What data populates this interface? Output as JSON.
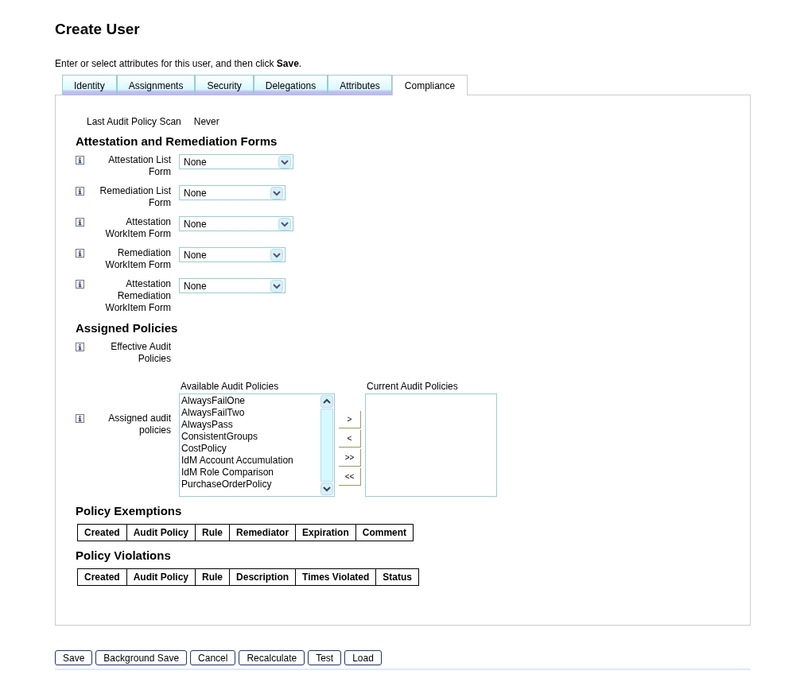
{
  "page": {
    "title": "Create User",
    "instruction": "Enter or select attributes for this user, and then click **Save**."
  },
  "tabs": [
    {
      "label": "Identity",
      "selected": false
    },
    {
      "label": "Assignments",
      "selected": false
    },
    {
      "label": "Security",
      "selected": false
    },
    {
      "label": "Delegations",
      "selected": false
    },
    {
      "label": "Attributes",
      "selected": false
    },
    {
      "label": "Compliance",
      "selected": true
    }
  ],
  "last_scan": {
    "label": "Last Audit Policy Scan",
    "value": "Never"
  },
  "forms_section": {
    "heading": "Attestation and Remediation Forms",
    "fields": [
      {
        "label": "Attestation List Form",
        "value": "None"
      },
      {
        "label": "Remediation List Form",
        "value": "None"
      },
      {
        "label": "Attestation WorkItem Form",
        "value": "None"
      },
      {
        "label": "Remediation WorkItem Form",
        "value": "None"
      },
      {
        "label": "Attestation Remediation WorkItem Form",
        "value": "None"
      }
    ]
  },
  "policies_section": {
    "heading": "Assigned Policies",
    "effective_label": "Effective Audit Policies",
    "assigned_label": "Assigned audit policies",
    "available_heading": "Available Audit Policies",
    "current_heading": "Current Audit Policies",
    "available": [
      "AlwaysFailOne",
      "AlwaysFailTwo",
      "AlwaysPass",
      "ConsistentGroups",
      "CostPolicy",
      "IdM Account Accumulation",
      "IdM Role Comparison",
      "PurchaseOrderPolicy"
    ],
    "move_buttons": [
      ">",
      "<",
      ">>",
      "<<"
    ]
  },
  "exemptions": {
    "heading": "Policy Exemptions",
    "columns": [
      "Created",
      "Audit Policy",
      "Rule",
      "Remediator",
      "Expiration",
      "Comment"
    ]
  },
  "violations": {
    "heading": "Policy Violations",
    "columns": [
      "Created",
      "Audit Policy",
      "Rule",
      "Description",
      "Times Violated",
      "Status"
    ]
  },
  "buttons": [
    "Save",
    "Background Save",
    "Cancel",
    "Recalculate",
    "Test",
    "Load"
  ]
}
